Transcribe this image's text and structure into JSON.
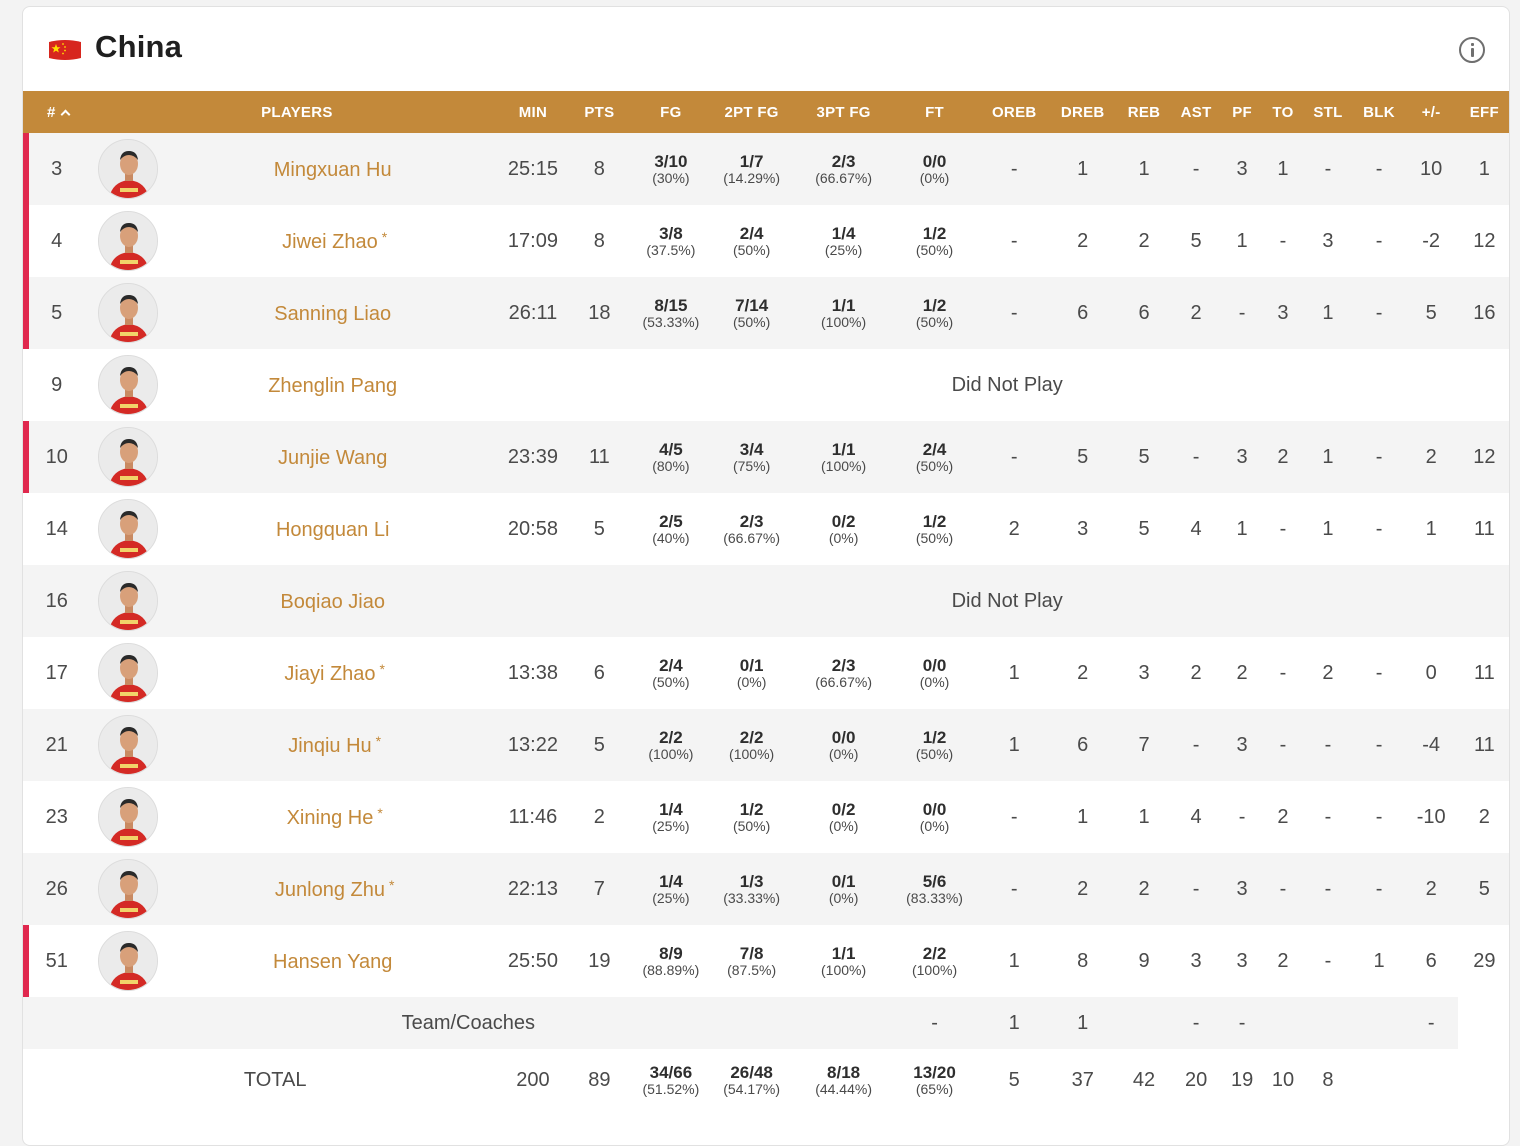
{
  "header": {
    "team_name": "China"
  },
  "columns": [
    "#",
    "PLAYERS",
    "MIN",
    "PTS",
    "FG",
    "2PT FG",
    "3PT FG",
    "FT",
    "OREB",
    "DREB",
    "REB",
    "AST",
    "PF",
    "TO",
    "STL",
    "BLK",
    "+/-",
    "EFF"
  ],
  "players": [
    {
      "num": "3",
      "name": "Mingxuan Hu",
      "star": "",
      "min": "25:15",
      "pts": "8",
      "fg_m": "3/10",
      "fg_p": "(30%)",
      "p2_m": "1/7",
      "p2_p": "(14.29%)",
      "p3_m": "2/3",
      "p3_p": "(66.67%)",
      "ft_m": "0/0",
      "ft_p": "(0%)",
      "oreb": "-",
      "dreb": "1",
      "reb": "1",
      "ast": "-",
      "pf": "3",
      "to": "1",
      "stl": "-",
      "blk": "-",
      "pm": "10",
      "eff": "1"
    },
    {
      "num": "4",
      "name": "Jiwei Zhao",
      "star": "*",
      "min": "17:09",
      "pts": "8",
      "fg_m": "3/8",
      "fg_p": "(37.5%)",
      "p2_m": "2/4",
      "p2_p": "(50%)",
      "p3_m": "1/4",
      "p3_p": "(25%)",
      "ft_m": "1/2",
      "ft_p": "(50%)",
      "oreb": "-",
      "dreb": "2",
      "reb": "2",
      "ast": "5",
      "pf": "1",
      "to": "-",
      "stl": "3",
      "blk": "-",
      "pm": "-2",
      "eff": "12"
    },
    {
      "num": "5",
      "name": "Sanning Liao",
      "star": "",
      "min": "26:11",
      "pts": "18",
      "fg_m": "8/15",
      "fg_p": "(53.33%)",
      "p2_m": "7/14",
      "p2_p": "(50%)",
      "p3_m": "1/1",
      "p3_p": "(100%)",
      "ft_m": "1/2",
      "ft_p": "(50%)",
      "oreb": "-",
      "dreb": "6",
      "reb": "6",
      "ast": "2",
      "pf": "-",
      "to": "3",
      "stl": "1",
      "blk": "-",
      "pm": "5",
      "eff": "16"
    },
    {
      "num": "9",
      "name": "Zhenglin Pang",
      "star": "",
      "dnp": "Did Not Play"
    },
    {
      "num": "10",
      "name": "Junjie Wang",
      "star": "",
      "min": "23:39",
      "pts": "11",
      "fg_m": "4/5",
      "fg_p": "(80%)",
      "p2_m": "3/4",
      "p2_p": "(75%)",
      "p3_m": "1/1",
      "p3_p": "(100%)",
      "ft_m": "2/4",
      "ft_p": "(50%)",
      "oreb": "-",
      "dreb": "5",
      "reb": "5",
      "ast": "-",
      "pf": "3",
      "to": "2",
      "stl": "1",
      "blk": "-",
      "pm": "2",
      "eff": "12"
    },
    {
      "num": "14",
      "name": "Hongquan Li",
      "star": "",
      "min": "20:58",
      "pts": "5",
      "fg_m": "2/5",
      "fg_p": "(40%)",
      "p2_m": "2/3",
      "p2_p": "(66.67%)",
      "p3_m": "0/2",
      "p3_p": "(0%)",
      "ft_m": "1/2",
      "ft_p": "(50%)",
      "oreb": "2",
      "dreb": "3",
      "reb": "5",
      "ast": "4",
      "pf": "1",
      "to": "-",
      "stl": "1",
      "blk": "-",
      "pm": "1",
      "eff": "11"
    },
    {
      "num": "16",
      "name": "Boqiao Jiao",
      "star": "",
      "dnp": "Did Not Play"
    },
    {
      "num": "17",
      "name": "Jiayi Zhao",
      "star": "*",
      "min": "13:38",
      "pts": "6",
      "fg_m": "2/4",
      "fg_p": "(50%)",
      "p2_m": "0/1",
      "p2_p": "(0%)",
      "p3_m": "2/3",
      "p3_p": "(66.67%)",
      "ft_m": "0/0",
      "ft_p": "(0%)",
      "oreb": "1",
      "dreb": "2",
      "reb": "3",
      "ast": "2",
      "pf": "2",
      "to": "-",
      "stl": "2",
      "blk": "-",
      "pm": "0",
      "eff": "11"
    },
    {
      "num": "21",
      "name": "Jinqiu Hu",
      "star": "*",
      "min": "13:22",
      "pts": "5",
      "fg_m": "2/2",
      "fg_p": "(100%)",
      "p2_m": "2/2",
      "p2_p": "(100%)",
      "p3_m": "0/0",
      "p3_p": "(0%)",
      "ft_m": "1/2",
      "ft_p": "(50%)",
      "oreb": "1",
      "dreb": "6",
      "reb": "7",
      "ast": "-",
      "pf": "3",
      "to": "-",
      "stl": "-",
      "blk": "-",
      "pm": "-4",
      "eff": "11"
    },
    {
      "num": "23",
      "name": "Xining He",
      "star": "*",
      "min": "11:46",
      "pts": "2",
      "fg_m": "1/4",
      "fg_p": "(25%)",
      "p2_m": "1/2",
      "p2_p": "(50%)",
      "p3_m": "0/2",
      "p3_p": "(0%)",
      "ft_m": "0/0",
      "ft_p": "(0%)",
      "oreb": "-",
      "dreb": "1",
      "reb": "1",
      "ast": "4",
      "pf": "-",
      "to": "2",
      "stl": "-",
      "blk": "-",
      "pm": "-10",
      "eff": "2"
    },
    {
      "num": "26",
      "name": "Junlong Zhu",
      "star": "*",
      "min": "22:13",
      "pts": "7",
      "fg_m": "1/4",
      "fg_p": "(25%)",
      "p2_m": "1/3",
      "p2_p": "(33.33%)",
      "p3_m": "0/1",
      "p3_p": "(0%)",
      "ft_m": "5/6",
      "ft_p": "(83.33%)",
      "oreb": "-",
      "dreb": "2",
      "reb": "2",
      "ast": "-",
      "pf": "3",
      "to": "-",
      "stl": "-",
      "blk": "-",
      "pm": "2",
      "eff": "5"
    },
    {
      "num": "51",
      "name": "Hansen Yang",
      "star": "",
      "min": "25:50",
      "pts": "19",
      "fg_m": "8/9",
      "fg_p": "(88.89%)",
      "p2_m": "7/8",
      "p2_p": "(87.5%)",
      "p3_m": "1/1",
      "p3_p": "(100%)",
      "ft_m": "2/2",
      "ft_p": "(100%)",
      "oreb": "1",
      "dreb": "8",
      "reb": "9",
      "ast": "3",
      "pf": "3",
      "to": "2",
      "stl": "-",
      "blk": "1",
      "pm": "6",
      "eff": "29"
    }
  ],
  "team_row": {
    "label": "Team/Coaches",
    "oreb": "-",
    "dreb": "1",
    "reb": "1",
    "ast": "",
    "pf": "-",
    "to": "-",
    "stl": "",
    "blk": "",
    "pm": "",
    "eff": "-"
  },
  "total_row": {
    "label": "TOTAL",
    "min": "200",
    "pts": "89",
    "fg_m": "34/66",
    "fg_p": "(51.52%)",
    "p2_m": "26/48",
    "p2_p": "(54.17%)",
    "p3_m": "8/18",
    "p3_p": "(44.44%)",
    "ft_m": "13/20",
    "ft_p": "(65%)",
    "oreb": "5",
    "dreb": "37",
    "reb": "42",
    "ast": "20",
    "pf": "19",
    "to": "10",
    "stl": "8"
  },
  "starter_numbers": [
    "3",
    "4",
    "5",
    "10",
    "51"
  ],
  "colors": {
    "accent": "#c3893a",
    "starter_marker": "#e0284e",
    "flag_red": "#d7261e",
    "flag_gold": "#ffde00"
  },
  "icons": {
    "flag": "china-flag-icon",
    "info": "info-icon",
    "sort": "sort-ascending-icon",
    "avatar": "player-avatar"
  }
}
